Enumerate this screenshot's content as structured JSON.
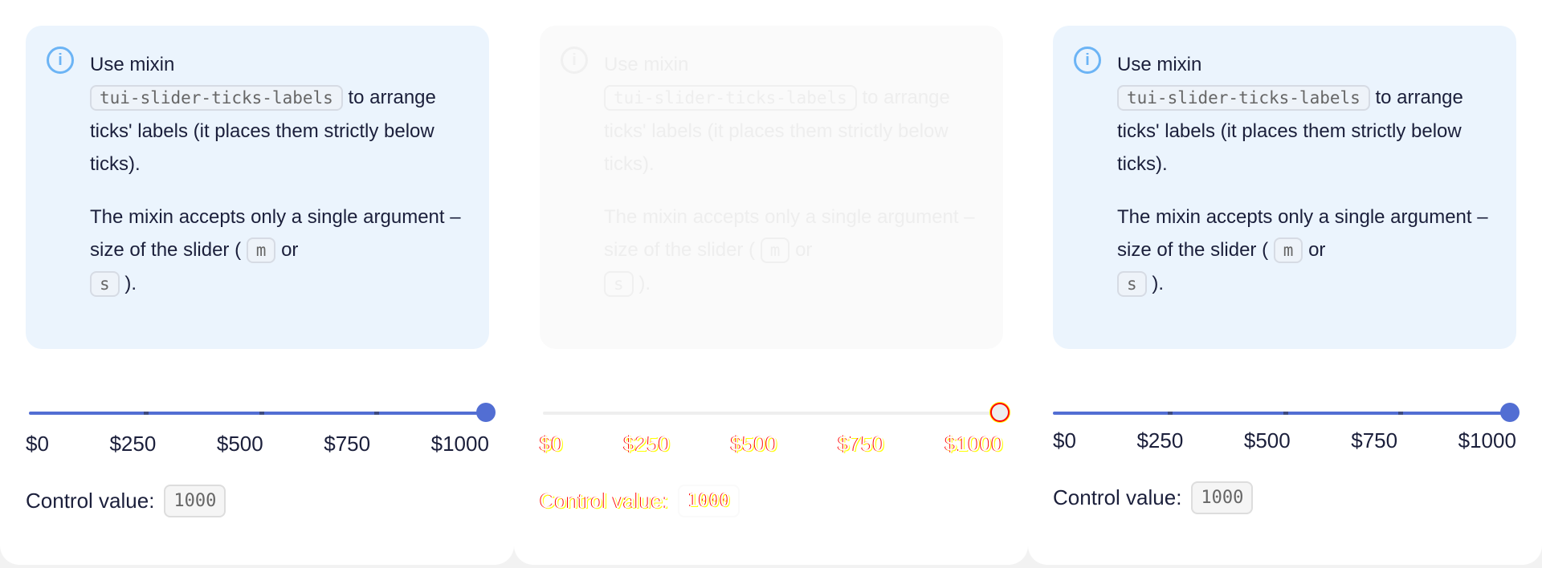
{
  "panels": [
    {
      "info": {
        "p1_a": "Use mixin",
        "p1_code": "tui-slider-ticks-labels",
        "p1_b": "to arrange ticks' labels (it places them strictly below ticks).",
        "p2_a": "The mixin accepts only a single argument – size of the slider (",
        "p2_m": "m",
        "p2_or": "or",
        "p2_s": "s",
        "p2_end": ")."
      },
      "ticks": [
        "$0",
        "$250",
        "$500",
        "$750",
        "$1000"
      ],
      "control_label": "Control value:",
      "control_value": "1000",
      "slider_value": 1000
    },
    {
      "info": {
        "p1_a": "Use mixin",
        "p1_code": "tui-slider-ticks-labels",
        "p1_b": "to arrange ticks' labels (it places them strictly below ticks).",
        "p2_a": "The mixin accepts only a single argument – size of the slider (",
        "p2_m": "m",
        "p2_or": "or",
        "p2_s": "s",
        "p2_end": ")."
      },
      "ticks": [
        "$0",
        "$250",
        "$500",
        "$750",
        "$1000"
      ],
      "control_label": "Control value:",
      "control_value": "1000",
      "slider_value": 1000
    },
    {
      "info": {
        "p1_a": "Use mixin",
        "p1_code": "tui-slider-ticks-labels",
        "p1_b": "to arrange ticks' labels (it places them strictly below ticks).",
        "p2_a": "The mixin accepts only a single argument – size of the slider (",
        "p2_m": "m",
        "p2_or": "or",
        "p2_s": "s",
        "p2_end": ")."
      },
      "ticks": [
        "$0",
        "$250",
        "$500",
        "$750",
        "$1000"
      ],
      "control_label": "Control value:",
      "control_value": "1000",
      "slider_value": 1000
    }
  ],
  "colors": {
    "accent": "#526ed3",
    "info_bg": "#ebf4fd",
    "info_icon": "#6cb4f5"
  }
}
